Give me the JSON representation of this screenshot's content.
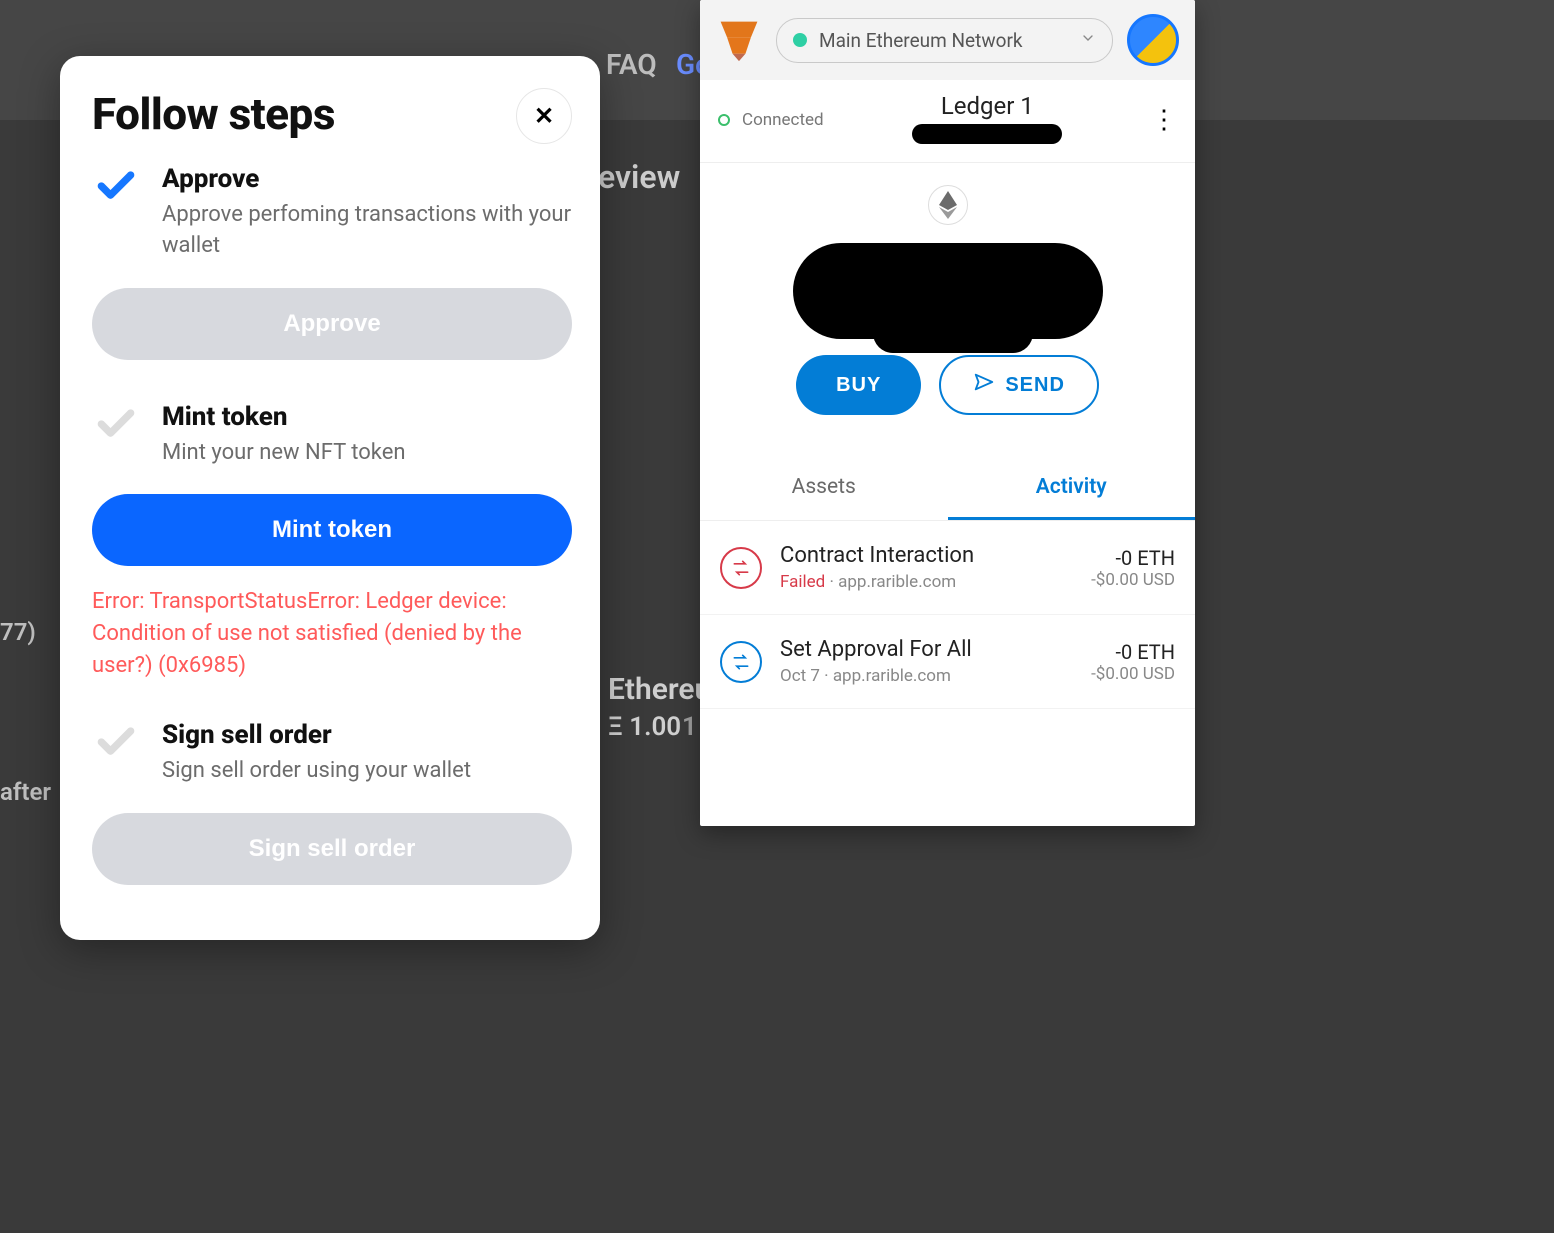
{
  "background": {
    "faq": "FAQ",
    "go": "Go",
    "review": "eview",
    "ethereu": "Ethereu",
    "price_eth": "Ξ 1.00",
    "one": "1",
    "seventy_seven": "77)",
    "after": "after"
  },
  "modal": {
    "title": "Follow steps",
    "close_symbol": "✕",
    "steps": [
      {
        "title": "Approve",
        "desc": "Approve perfoming transactions with your wallet",
        "button": "Approve",
        "state": "done"
      },
      {
        "title": "Mint token",
        "desc": "Mint your new NFT token",
        "button": "Mint token",
        "state": "active"
      },
      {
        "title": "Sign sell order",
        "desc": "Sign sell order using your wallet",
        "button": "Sign sell order",
        "state": "pending"
      }
    ],
    "error": "Error: TransportStatusError: Ledger device: Condition of use not satisfied (denied by the user?) (0x6985)"
  },
  "metamask": {
    "network": "Main Ethereum Network",
    "connected_label": "Connected",
    "account_name": "Ledger 1",
    "buy": "BUY",
    "send": "SEND",
    "tabs": {
      "assets": "Assets",
      "activity": "Activity"
    },
    "items": [
      {
        "title": "Contract Interaction",
        "status": "Failed",
        "site": "app.rarible.com",
        "amount": "-0 ETH",
        "usd": "-$0.00 USD",
        "color": "red"
      },
      {
        "title": "Set Approval For All",
        "status": "Oct 7",
        "site": "app.rarible.com",
        "amount": "-0 ETH",
        "usd": "-$0.00 USD",
        "color": "blue"
      }
    ]
  }
}
